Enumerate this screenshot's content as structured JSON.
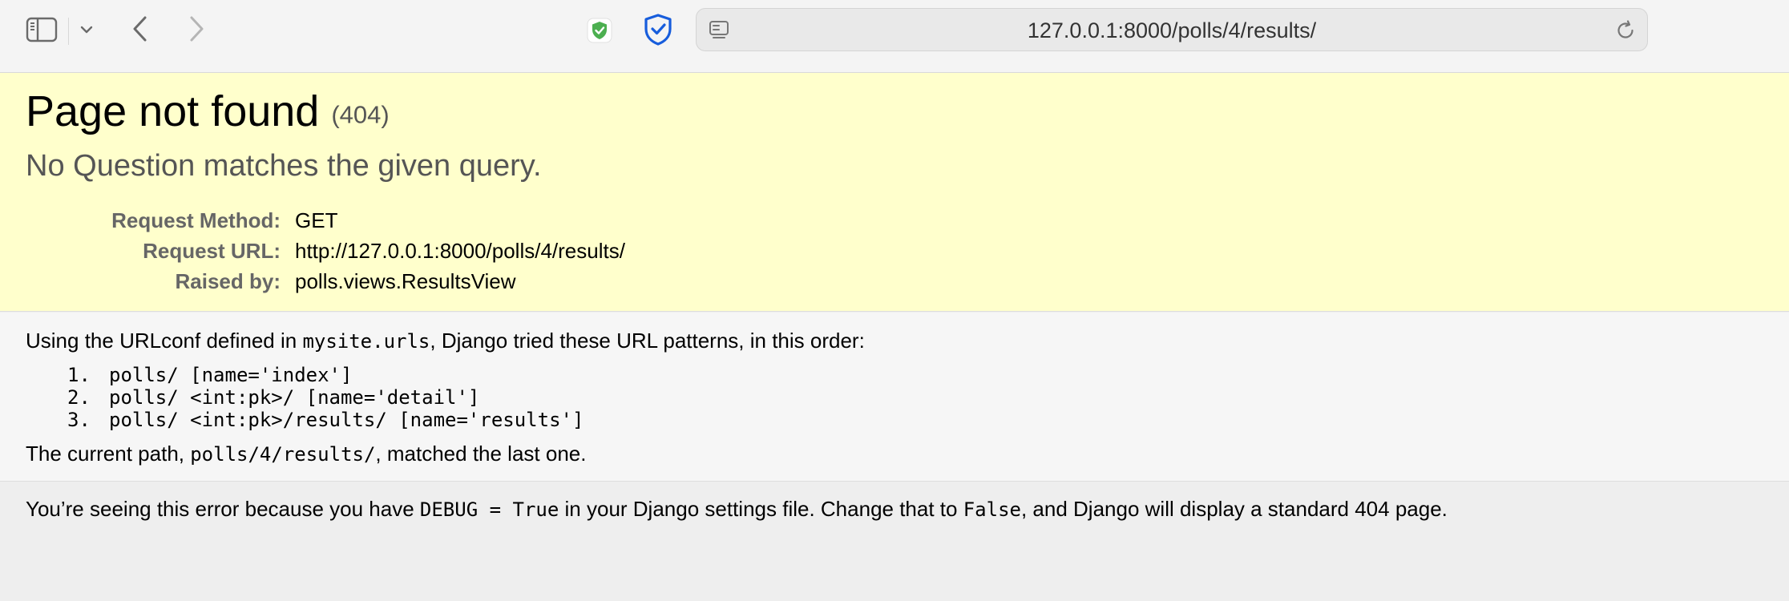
{
  "browser": {
    "url": "127.0.0.1:8000/polls/4/results/"
  },
  "error": {
    "title": "Page not found",
    "code": "(404)",
    "message": "No Question matches the given query.",
    "meta": [
      {
        "label": "Request Method:",
        "value": "GET"
      },
      {
        "label": "Request URL:",
        "value": "http://127.0.0.1:8000/polls/4/results/"
      },
      {
        "label": "Raised by:",
        "value": "polls.views.ResultsView"
      }
    ]
  },
  "info": {
    "intro_before": "Using the URLconf defined in ",
    "intro_code": "mysite.urls",
    "intro_after": ", Django tried these URL patterns, in this order:",
    "patterns": [
      {
        "num": "1.",
        "pattern": "polls/ [name='index']"
      },
      {
        "num": "2.",
        "pattern": "polls/ <int:pk>/ [name='detail']"
      },
      {
        "num": "3.",
        "pattern": "polls/ <int:pk>/results/ [name='results']"
      }
    ],
    "current_before": "The current path, ",
    "current_code": "polls/4/results/",
    "current_after": ", matched the last one."
  },
  "explanation": {
    "before": "You’re seeing this error because you have ",
    "code1": "DEBUG = True",
    "middle": " in your Django settings file. Change that to ",
    "code2": "False",
    "after": ", and Django will display a standard 404 page."
  },
  "icons": {
    "sidebar": "sidebar-icon",
    "tab_overview": "chevron-down-icon",
    "back": "chevron-left-icon",
    "forward": "chevron-right-icon",
    "ext1": "green-shield-icon",
    "ext2": "bitwarden-shield-icon",
    "page_menu": "page-menu-icon",
    "reload": "reload-icon"
  },
  "colors": {
    "summary_bg": "#ffffcc",
    "info_bg": "#f6f6f6",
    "explanation_bg": "#eeeeee",
    "toolbar_bg": "#f4f4f4",
    "bitwarden_blue": "#175ddc",
    "shield_green": "#4caf50"
  }
}
